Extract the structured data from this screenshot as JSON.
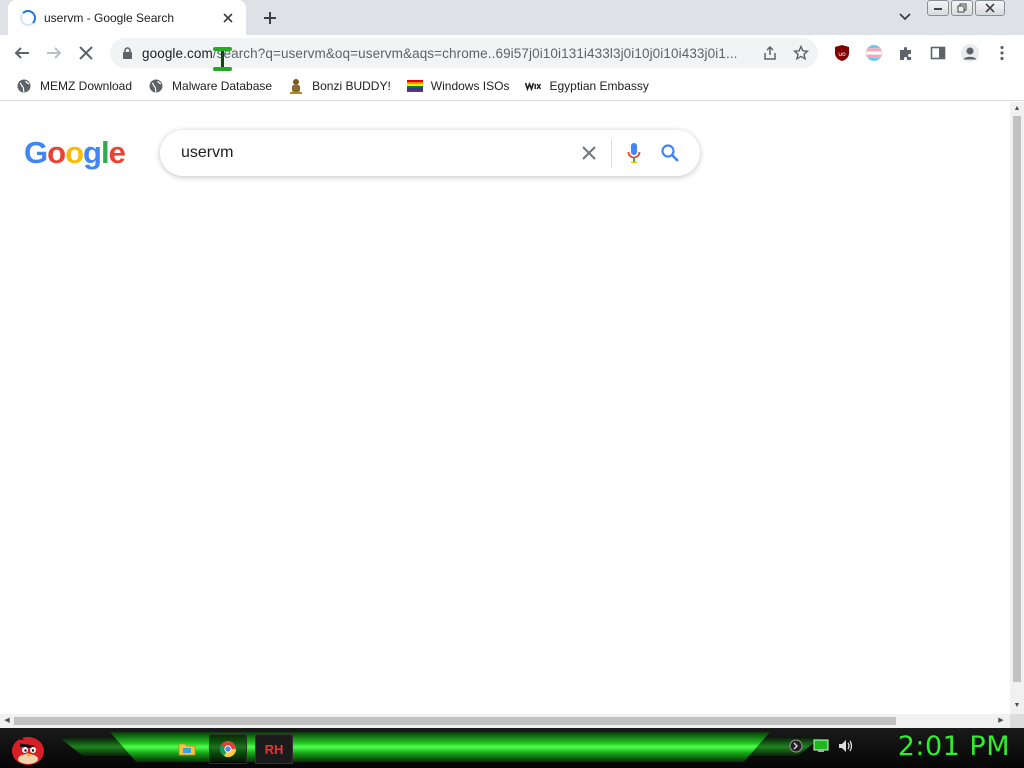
{
  "tab": {
    "title": "uservm - Google Search",
    "loading": true
  },
  "toolbar": {
    "url_host": "google.com",
    "url_rest": "/search?q=uservm&oq=uservm&aqs=chrome..69i57j0i10i131i433l3j0i10j0i10i433j0i1..."
  },
  "bookmarks": [
    {
      "label": "MEMZ Download",
      "icon": "globe-icon"
    },
    {
      "label": "Malware Database",
      "icon": "globe-icon"
    },
    {
      "label": "Bonzi BUDDY!",
      "icon": "bonzi-icon"
    },
    {
      "label": "Windows ISOs",
      "icon": "rainbow-flag-icon"
    },
    {
      "label": "Egyptian Embassy",
      "icon": "wix-icon"
    }
  ],
  "page": {
    "logo": "Google",
    "search_query": "uservm"
  },
  "taskbar": {
    "rh_label": "RH",
    "clock": "2:01 PM"
  },
  "colors": {
    "google_blue": "#4285F4",
    "google_red": "#EA4335",
    "google_yellow": "#FBBC05",
    "google_green": "#34A853",
    "clock_green": "#2cf02c"
  }
}
